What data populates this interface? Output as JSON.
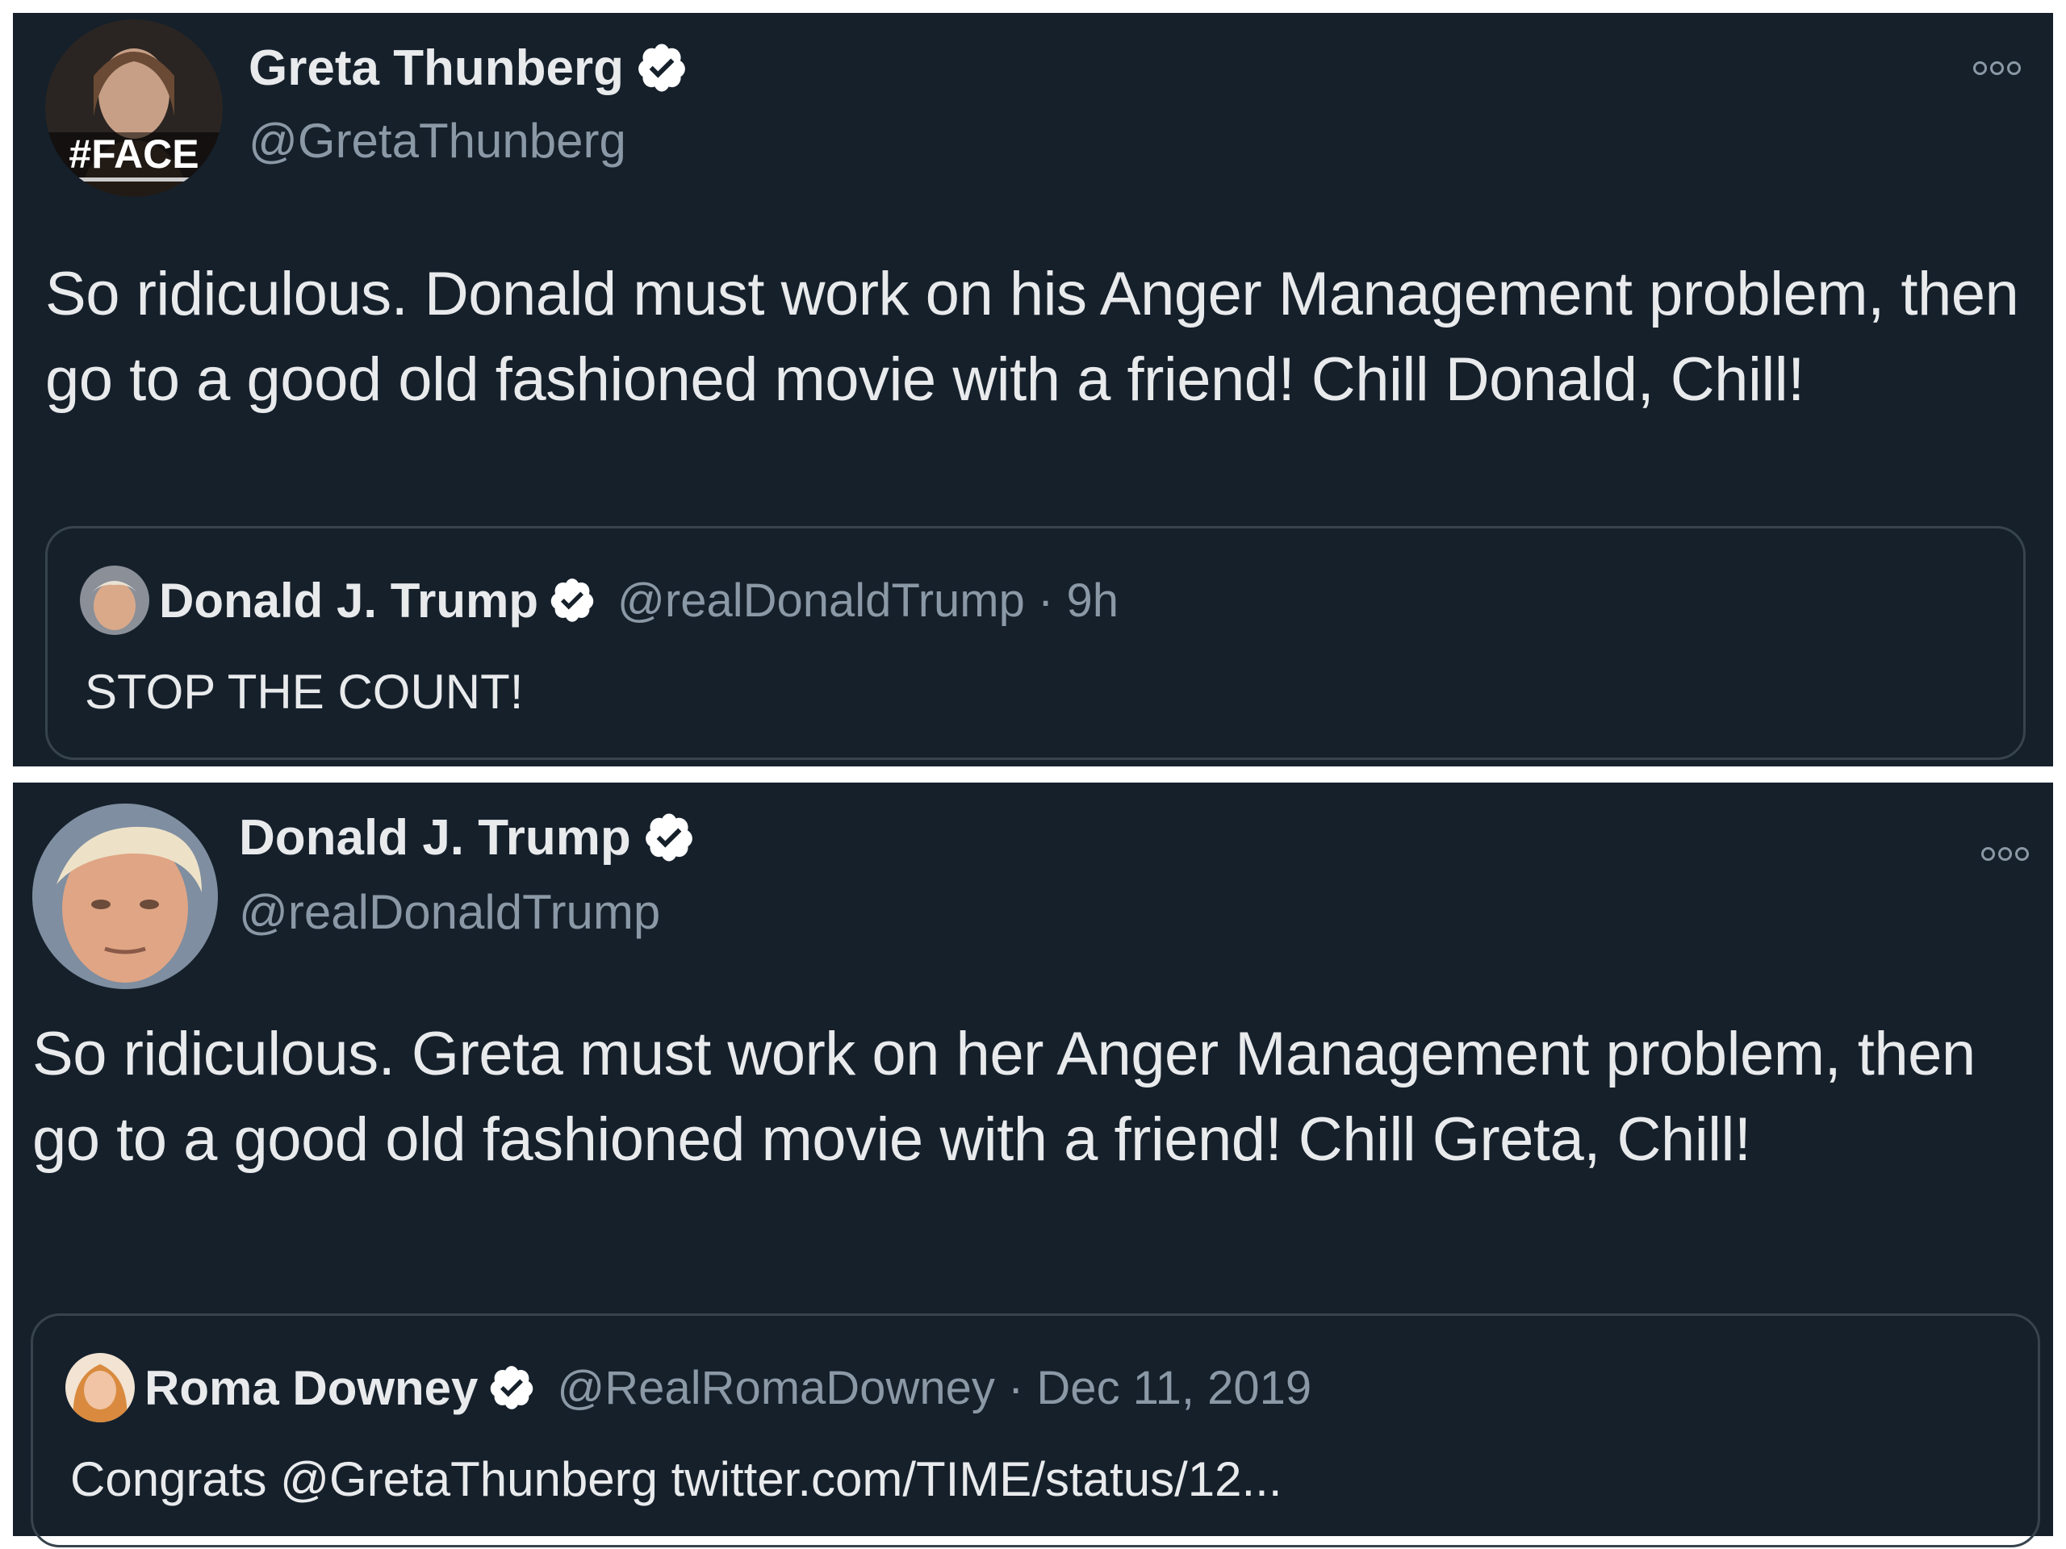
{
  "colors": {
    "background": "#15202b",
    "text": "#e8eaec",
    "muted": "#8b98a5",
    "border": "#38444d"
  },
  "tweets": [
    {
      "author": {
        "display_name": "Greta Thunberg",
        "handle": "@GretaThunberg",
        "verified": true,
        "avatar_overlay_text": "#FACE"
      },
      "text": "So ridiculous. Donald must work on his Anger Management problem, then go to a good old fashioned movie with a friend! Chill Donald, Chill!",
      "more_icon": "more-dots-icon",
      "quoted": {
        "display_name": "Donald J. Trump",
        "verified": true,
        "handle": "@realDonaldTrump",
        "separator": "·",
        "time": "9h",
        "text": "STOP THE COUNT!"
      }
    },
    {
      "author": {
        "display_name": "Donald J. Trump",
        "handle": "@realDonaldTrump",
        "verified": true
      },
      "text": "So ridiculous. Greta must work on her Anger Management problem, then go to a good old fashioned movie with a friend! Chill Greta, Chill!",
      "more_icon": "more-dots-icon",
      "quoted": {
        "display_name": "Roma Downey",
        "verified": true,
        "handle": "@RealRomaDowney",
        "separator": "·",
        "time": "Dec 11, 2019",
        "text": "Congrats @GretaThunberg twitter.com/TIME/status/12..."
      }
    }
  ]
}
